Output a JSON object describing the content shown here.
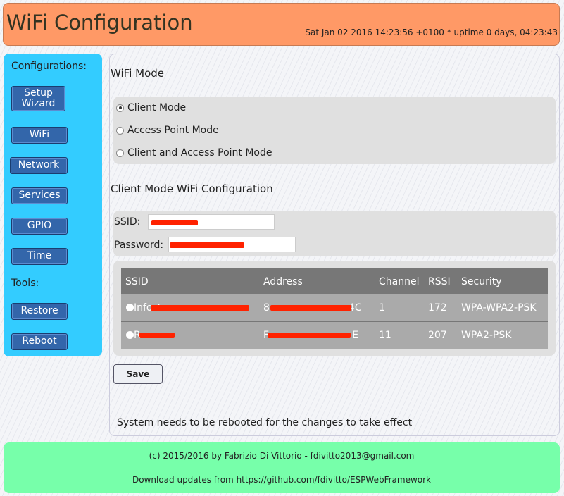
{
  "header": {
    "title": "WiFi Configuration",
    "status": "Sat Jan 02 2016 14:23:56 +0100 * uptime 0 days, 04:23:43"
  },
  "sidebar": {
    "configurations_label": "Configurations:",
    "tools_label": "Tools:",
    "config_items": [
      {
        "label": "Setup Wizard"
      },
      {
        "label": "WiFi"
      },
      {
        "label": "Network"
      },
      {
        "label": "Services"
      },
      {
        "label": "GPIO"
      },
      {
        "label": "Time"
      }
    ],
    "tool_items": [
      {
        "label": "Restore"
      },
      {
        "label": "Reboot"
      }
    ]
  },
  "main": {
    "wifi_mode_title": "WiFi Mode",
    "modes": [
      {
        "label": "Client Mode",
        "selected": true
      },
      {
        "label": "Access Point Mode",
        "selected": false
      },
      {
        "label": "Client and Access Point Mode",
        "selected": false
      }
    ],
    "client_title": "Client Mode WiFi Configuration",
    "ssid_label": "SSID:",
    "password_label": "Password:",
    "table": {
      "headers": [
        "SSID",
        "Address",
        "Channel",
        "RSSI",
        "Security"
      ],
      "rows": [
        {
          "ssid": "Infost",
          "address_start": "8",
          "address_end": "4C",
          "channel": "1",
          "rssi": "172",
          "security": "WPA-WPA2-PSK"
        },
        {
          "ssid": "R",
          "address_start": "F",
          "address_end": "E",
          "channel": "11",
          "rssi": "207",
          "security": "WPA2-PSK"
        }
      ]
    },
    "save_label": "Save",
    "reboot_notice": "System needs to be rebooted for the changes to take effect"
  },
  "footer": {
    "copyright": "(c) 2015/2016 by Fabrizio Di Vittorio - fdivitto2013@gmail.com",
    "download_text": "Download updates from",
    "download_link": "https://github.com/fdivitto/ESPWebFramework"
  },
  "colors": {
    "header": "#ff9966",
    "sidebar": "#33ccff",
    "button": "#3366aa",
    "footer": "#77ffaa",
    "redaction": "#ff2200"
  }
}
